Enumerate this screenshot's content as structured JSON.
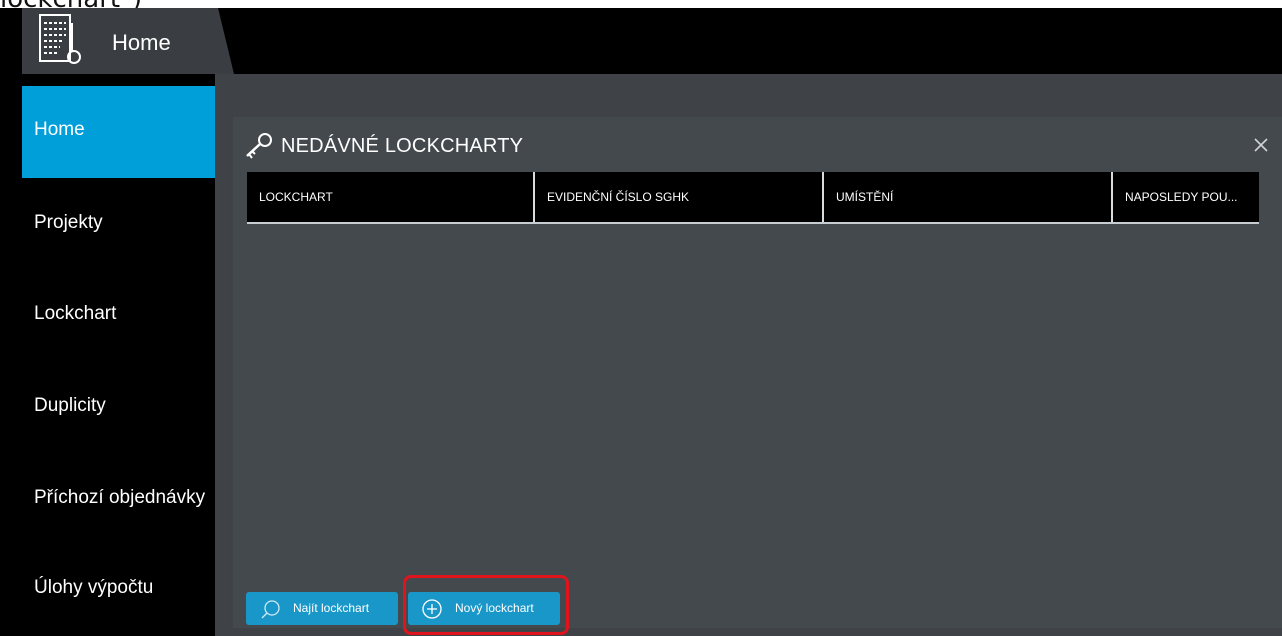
{
  "caption": {
    "text": "lockchart\")"
  },
  "titlebar": {
    "home_tab_label": "Home",
    "home_icon": "document-key-icon"
  },
  "sidebar": {
    "items": [
      {
        "label": "Home",
        "active": true
      },
      {
        "label": "Projekty"
      },
      {
        "label": "Lockchart"
      },
      {
        "label": "Duplicity"
      },
      {
        "label": "Příchozí objednávky"
      },
      {
        "label": "Úlohy výpočtu"
      }
    ]
  },
  "panel": {
    "title": "NEDÁVNÉ LOCKCHARTY",
    "title_icon": "key-icon",
    "close_icon": "close-icon",
    "columns": [
      "LOCKCHART",
      "EVIDENČNÍ ČÍSLO SGHK",
      "UMÍSTĚNÍ",
      "NAPOSLEDY POU..."
    ],
    "rows": []
  },
  "buttons": {
    "find_label": "Najít lockchart",
    "new_label": "Nový lockchart"
  },
  "colors": {
    "accent": "#009fd9",
    "button": "#1a97c9",
    "highlight": "#e0141c",
    "panel": "#44494d"
  }
}
